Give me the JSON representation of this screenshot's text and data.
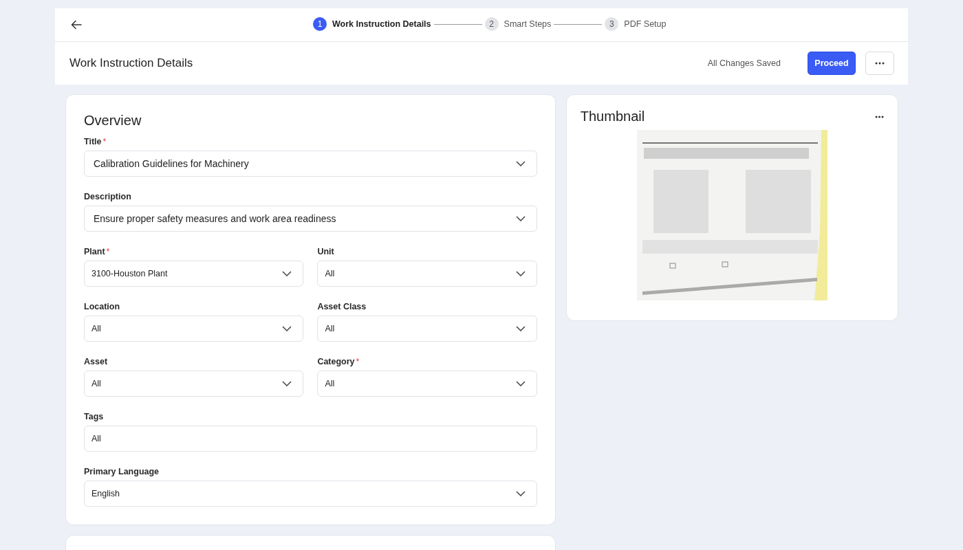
{
  "steps": [
    {
      "number": "1",
      "label": "Work Instruction Details",
      "selected": true
    },
    {
      "number": "2",
      "label": "Smart Steps",
      "selected": false
    },
    {
      "number": "3",
      "label": "PDF Setup",
      "selected": false
    }
  ],
  "header": {
    "title": "Work Instruction Details",
    "save_status": "All Changes Saved",
    "proceed_button": "Proceed"
  },
  "overview": {
    "title": "Overview",
    "rows": [
      [
        {
          "label": "Title",
          "required_mark": "*",
          "value": "Calibration Guidelines for Machinery",
          "kind": "select",
          "large": true
        }
      ],
      [
        {
          "label": "Description",
          "value": "Ensure proper safety measures and work area readiness",
          "kind": "select",
          "large": true
        }
      ],
      [
        {
          "label": "Plant",
          "required_mark": "*",
          "value": "3100-Houston Plant",
          "kind": "select"
        },
        {
          "label": "Unit",
          "value": "All",
          "kind": "select"
        }
      ],
      [
        {
          "label": "Location",
          "value": "All",
          "kind": "select"
        },
        {
          "label": "Asset Class",
          "value": "All",
          "kind": "select"
        }
      ],
      [
        {
          "label": "Asset",
          "value": "All",
          "kind": "select"
        },
        {
          "label": "Category",
          "required_mark": "*",
          "value": "All",
          "kind": "select"
        }
      ],
      [
        {
          "label": "Tags",
          "value": "All",
          "kind": "text"
        }
      ],
      [
        {
          "label": "Primary Language",
          "value": "English",
          "kind": "select"
        }
      ]
    ]
  },
  "thumbnail": {
    "title": "Thumbnail"
  }
}
